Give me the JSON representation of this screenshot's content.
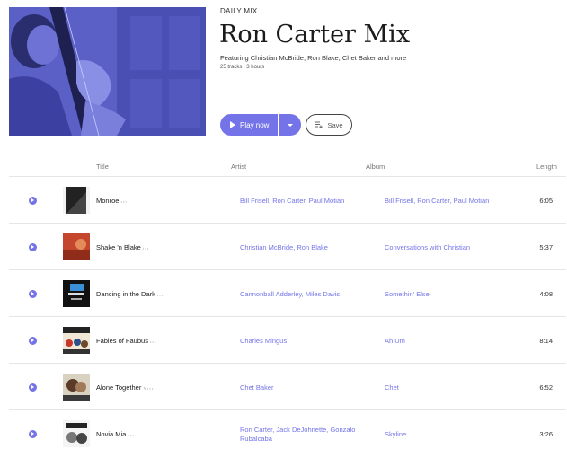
{
  "playlist": {
    "kicker": "DAILY MIX",
    "title": "Ron Carter Mix",
    "featuring": "Featuring Christian McBride, Ron Blake, Chet Baker and more",
    "meta": "25 tracks | 3 hours"
  },
  "actions": {
    "play_label": "Play now",
    "save_label": "Save"
  },
  "table": {
    "headers": {
      "title": "Title",
      "artist": "Artist",
      "album": "Album",
      "length": "Length"
    },
    "rows": [
      {
        "title": "Monroe",
        "artist": "Bill Frisell, Ron Carter, Paul Motian",
        "album": "Bill Frisell, Ron Carter, Paul Motian",
        "length": "6:05"
      },
      {
        "title": "Shake 'n Blake",
        "artist": "Christian McBride, Ron Blake",
        "album": "Conversations with Christian",
        "length": "5:37"
      },
      {
        "title": "Dancing in the Dark",
        "artist": "Cannonball Adderley, Miles Davis",
        "album": "Somethin' Else",
        "length": "4:08"
      },
      {
        "title": "Fables of Faubus",
        "artist": "Charles Mingus",
        "album": "Ah Um",
        "length": "8:14"
      },
      {
        "title": "Alone Together",
        "artist": "Chet Baker",
        "album": "Chet",
        "length": "6:52"
      },
      {
        "title": "Novia Mia",
        "artist_line1": "Ron Carter, Jack DeJohnette, Gonzalo",
        "artist_line2": "Rubalcaba",
        "album": "Skyline",
        "length": "3:26"
      }
    ]
  },
  "colors": {
    "accent": "#7474e8",
    "cover_tint": "#5a5fc4"
  }
}
